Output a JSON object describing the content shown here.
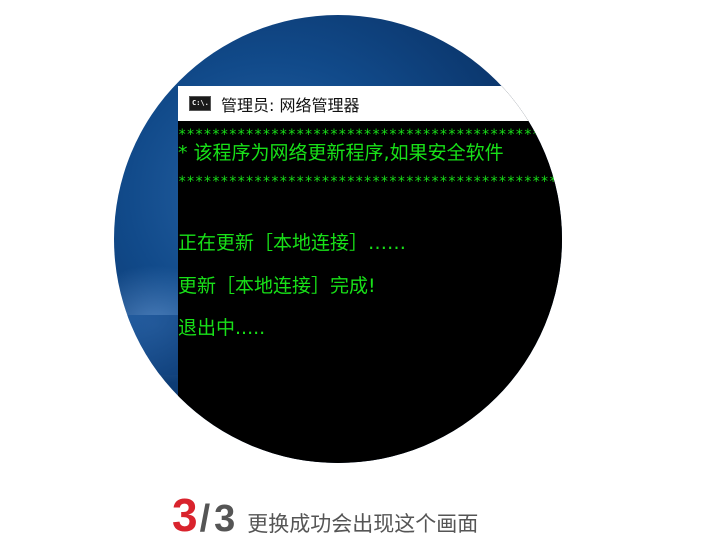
{
  "window": {
    "title": "管理员: 网络管理器",
    "icon": "cmd-icon",
    "icon_glyph": "C:\\."
  },
  "console": {
    "lines": [
      "*****************************************************",
      "* 该程序为网络更新程序,如果安全软件",
      "*****************************************************",
      "正在更新［本地连接］……",
      "更新［本地连接］完成!",
      "退出中....."
    ],
    "text_color": "#18e018",
    "background_color": "#000000"
  },
  "caption": {
    "current_step": "3",
    "slash": "/",
    "total_steps": "3",
    "text": "更换成功会出现这个画面",
    "accent_color": "#d9232d",
    "text_color": "#555555"
  },
  "background": {
    "desktop_color": "#114a8a"
  }
}
